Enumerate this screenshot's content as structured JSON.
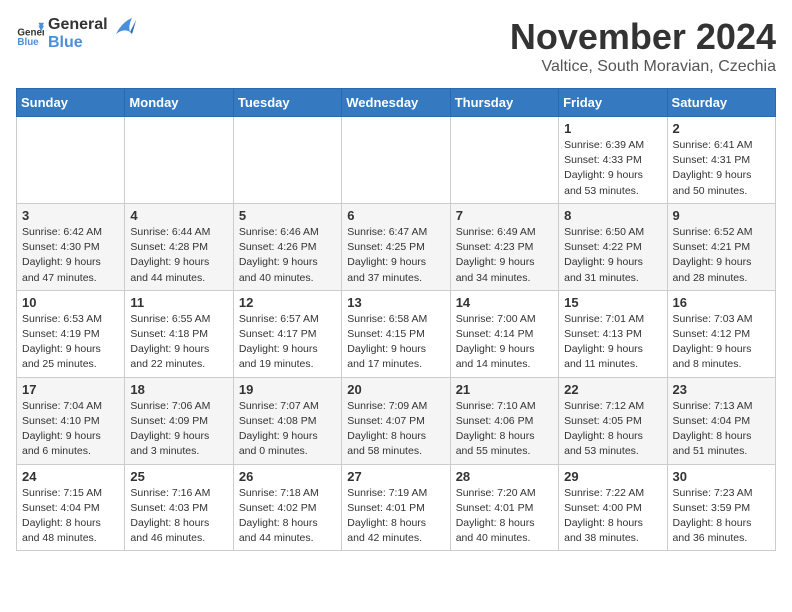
{
  "header": {
    "logo": {
      "general": "General",
      "blue": "Blue"
    },
    "month": "November 2024",
    "location": "Valtice, South Moravian, Czechia"
  },
  "weekdays": [
    "Sunday",
    "Monday",
    "Tuesday",
    "Wednesday",
    "Thursday",
    "Friday",
    "Saturday"
  ],
  "weeks": [
    [
      {
        "day": "",
        "info": ""
      },
      {
        "day": "",
        "info": ""
      },
      {
        "day": "",
        "info": ""
      },
      {
        "day": "",
        "info": ""
      },
      {
        "day": "",
        "info": ""
      },
      {
        "day": "1",
        "info": "Sunrise: 6:39 AM\nSunset: 4:33 PM\nDaylight: 9 hours\nand 53 minutes."
      },
      {
        "day": "2",
        "info": "Sunrise: 6:41 AM\nSunset: 4:31 PM\nDaylight: 9 hours\nand 50 minutes."
      }
    ],
    [
      {
        "day": "3",
        "info": "Sunrise: 6:42 AM\nSunset: 4:30 PM\nDaylight: 9 hours\nand 47 minutes."
      },
      {
        "day": "4",
        "info": "Sunrise: 6:44 AM\nSunset: 4:28 PM\nDaylight: 9 hours\nand 44 minutes."
      },
      {
        "day": "5",
        "info": "Sunrise: 6:46 AM\nSunset: 4:26 PM\nDaylight: 9 hours\nand 40 minutes."
      },
      {
        "day": "6",
        "info": "Sunrise: 6:47 AM\nSunset: 4:25 PM\nDaylight: 9 hours\nand 37 minutes."
      },
      {
        "day": "7",
        "info": "Sunrise: 6:49 AM\nSunset: 4:23 PM\nDaylight: 9 hours\nand 34 minutes."
      },
      {
        "day": "8",
        "info": "Sunrise: 6:50 AM\nSunset: 4:22 PM\nDaylight: 9 hours\nand 31 minutes."
      },
      {
        "day": "9",
        "info": "Sunrise: 6:52 AM\nSunset: 4:21 PM\nDaylight: 9 hours\nand 28 minutes."
      }
    ],
    [
      {
        "day": "10",
        "info": "Sunrise: 6:53 AM\nSunset: 4:19 PM\nDaylight: 9 hours\nand 25 minutes."
      },
      {
        "day": "11",
        "info": "Sunrise: 6:55 AM\nSunset: 4:18 PM\nDaylight: 9 hours\nand 22 minutes."
      },
      {
        "day": "12",
        "info": "Sunrise: 6:57 AM\nSunset: 4:17 PM\nDaylight: 9 hours\nand 19 minutes."
      },
      {
        "day": "13",
        "info": "Sunrise: 6:58 AM\nSunset: 4:15 PM\nDaylight: 9 hours\nand 17 minutes."
      },
      {
        "day": "14",
        "info": "Sunrise: 7:00 AM\nSunset: 4:14 PM\nDaylight: 9 hours\nand 14 minutes."
      },
      {
        "day": "15",
        "info": "Sunrise: 7:01 AM\nSunset: 4:13 PM\nDaylight: 9 hours\nand 11 minutes."
      },
      {
        "day": "16",
        "info": "Sunrise: 7:03 AM\nSunset: 4:12 PM\nDaylight: 9 hours\nand 8 minutes."
      }
    ],
    [
      {
        "day": "17",
        "info": "Sunrise: 7:04 AM\nSunset: 4:10 PM\nDaylight: 9 hours\nand 6 minutes."
      },
      {
        "day": "18",
        "info": "Sunrise: 7:06 AM\nSunset: 4:09 PM\nDaylight: 9 hours\nand 3 minutes."
      },
      {
        "day": "19",
        "info": "Sunrise: 7:07 AM\nSunset: 4:08 PM\nDaylight: 9 hours\nand 0 minutes."
      },
      {
        "day": "20",
        "info": "Sunrise: 7:09 AM\nSunset: 4:07 PM\nDaylight: 8 hours\nand 58 minutes."
      },
      {
        "day": "21",
        "info": "Sunrise: 7:10 AM\nSunset: 4:06 PM\nDaylight: 8 hours\nand 55 minutes."
      },
      {
        "day": "22",
        "info": "Sunrise: 7:12 AM\nSunset: 4:05 PM\nDaylight: 8 hours\nand 53 minutes."
      },
      {
        "day": "23",
        "info": "Sunrise: 7:13 AM\nSunset: 4:04 PM\nDaylight: 8 hours\nand 51 minutes."
      }
    ],
    [
      {
        "day": "24",
        "info": "Sunrise: 7:15 AM\nSunset: 4:04 PM\nDaylight: 8 hours\nand 48 minutes."
      },
      {
        "day": "25",
        "info": "Sunrise: 7:16 AM\nSunset: 4:03 PM\nDaylight: 8 hours\nand 46 minutes."
      },
      {
        "day": "26",
        "info": "Sunrise: 7:18 AM\nSunset: 4:02 PM\nDaylight: 8 hours\nand 44 minutes."
      },
      {
        "day": "27",
        "info": "Sunrise: 7:19 AM\nSunset: 4:01 PM\nDaylight: 8 hours\nand 42 minutes."
      },
      {
        "day": "28",
        "info": "Sunrise: 7:20 AM\nSunset: 4:01 PM\nDaylight: 8 hours\nand 40 minutes."
      },
      {
        "day": "29",
        "info": "Sunrise: 7:22 AM\nSunset: 4:00 PM\nDaylight: 8 hours\nand 38 minutes."
      },
      {
        "day": "30",
        "info": "Sunrise: 7:23 AM\nSunset: 3:59 PM\nDaylight: 8 hours\nand 36 minutes."
      }
    ]
  ]
}
